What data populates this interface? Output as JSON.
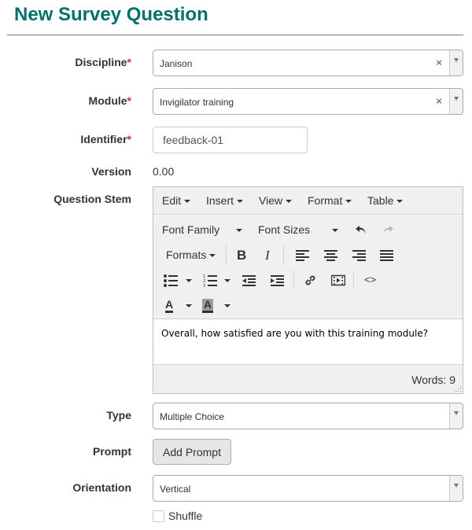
{
  "page": {
    "title": "New Survey Question"
  },
  "fields": {
    "discipline": {
      "label": "Discipline",
      "required_mark": "*",
      "value": "Janison",
      "clear_symbol": "×"
    },
    "module": {
      "label": "Module",
      "required_mark": "*",
      "value": "Invigilator training",
      "clear_symbol": "×"
    },
    "identifier": {
      "label": "Identifier",
      "required_mark": "*",
      "value": "feedback-01"
    },
    "version": {
      "label": "Version",
      "value": "0.00"
    },
    "question_stem": {
      "label": "Question Stem"
    },
    "type": {
      "label": "Type",
      "value": "Multiple Choice"
    },
    "prompt": {
      "label": "Prompt",
      "button_label": "Add Prompt"
    },
    "orientation": {
      "label": "Orientation",
      "value": "Vertical"
    },
    "shuffle": {
      "label": "Shuffle",
      "checked": false
    }
  },
  "editor": {
    "menu": [
      "Edit",
      "Insert",
      "View",
      "Format",
      "Table"
    ],
    "font_family_label": "Font Family",
    "font_sizes_label": "Font Sizes",
    "formats_label": "Formats",
    "bold_glyph": "B",
    "italic_glyph": "I",
    "text_color_glyph": "A",
    "bg_color_glyph": "A",
    "code_glyph": "<>",
    "content": "Overall, how satisfied are you with this training module?",
    "word_count": "Words: 9"
  }
}
